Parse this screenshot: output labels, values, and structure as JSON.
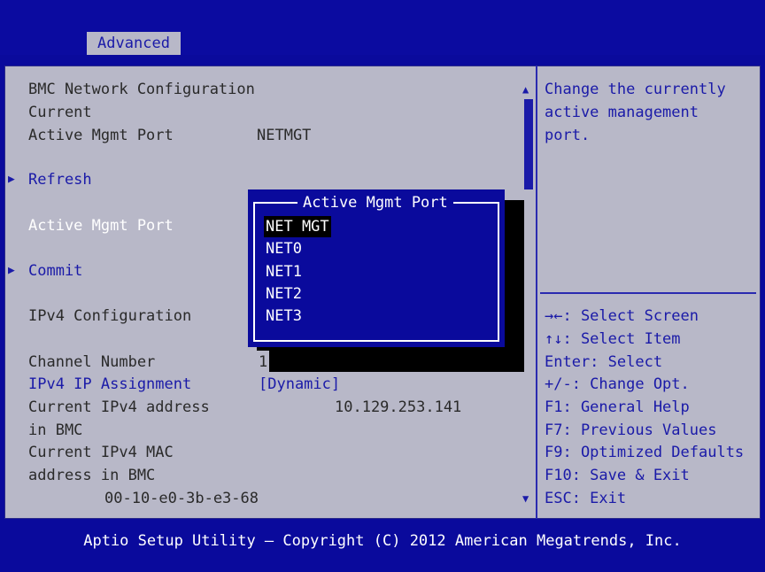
{
  "header": {
    "active_tab": "Advanced"
  },
  "settings": {
    "section_title": "BMC Network Configuration",
    "current_label": "Current",
    "current_port_label": "Active Mgmt Port",
    "current_port_value": "NETMGT",
    "refresh": "Refresh",
    "active_port_label": "Active Mgmt Port",
    "commit": "Commit",
    "ipv4_config": "IPv4 Configuration",
    "channel_label": "Channel Number",
    "channel_value": "1",
    "ip_assign_label": "IPv4 IP Assignment",
    "ip_assign_value": "[Dynamic]",
    "cur_ip_label_1": "Current IPv4 address",
    "cur_ip_label_2": "in BMC",
    "cur_ip_value": "10.129.253.141",
    "mac_label_1": "Current IPv4 MAC",
    "mac_label_2": "address in BMC",
    "mac_value": "00-10-e0-3b-e3-68"
  },
  "popup": {
    "title": "Active Mgmt Port",
    "options": [
      "NET MGT",
      "NET0",
      "NET1",
      "NET2",
      "NET3"
    ],
    "selected_index": 0
  },
  "help": {
    "line1": "Change the currently",
    "line2": "active management",
    "line3": "port."
  },
  "keys": [
    "→←: Select Screen",
    "↑↓: Select Item",
    "Enter: Select",
    "+/-: Change Opt.",
    "F1: General Help",
    "F7: Previous Values",
    "F9: Optimized Defaults",
    "F10: Save & Exit",
    "ESC: Exit"
  ],
  "footer": "Aptio Setup Utility – Copyright (C) 2012 American Megatrends, Inc."
}
